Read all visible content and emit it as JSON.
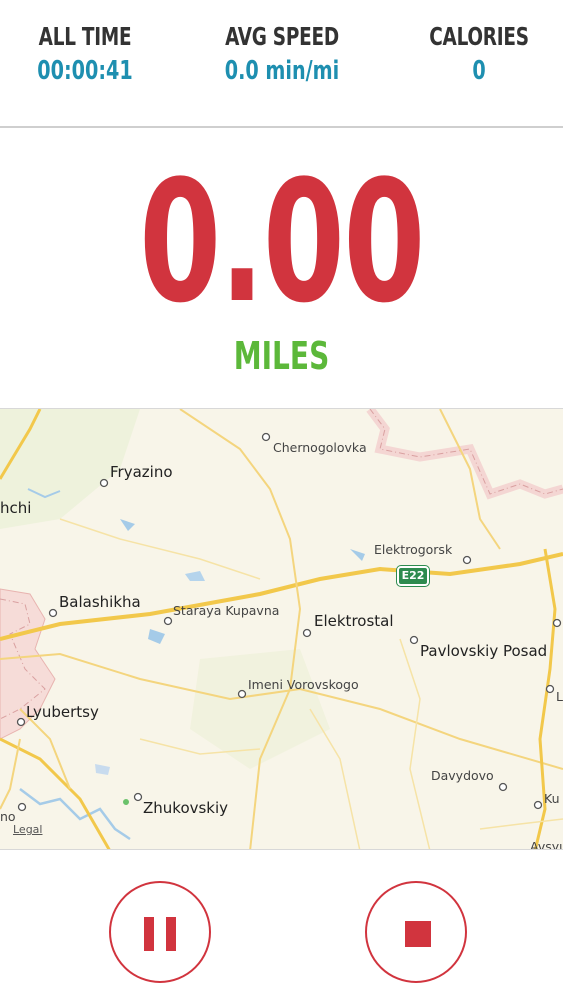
{
  "stats": [
    {
      "label": "ALL TIME",
      "value": "00:00:41"
    },
    {
      "label": "AVG SPEED",
      "value": "0.0 min/mi"
    },
    {
      "label": "CALORIES",
      "value": "0"
    }
  ],
  "distance": {
    "value": "0.00",
    "unit": "MILES"
  },
  "map": {
    "places": [
      {
        "name": "Chernogolovka",
        "size": "small"
      },
      {
        "name": "Fryazino",
        "size": "small"
      },
      {
        "name": "hchi",
        "size": "big"
      },
      {
        "name": "Elektrogorsk",
        "size": "small"
      },
      {
        "name": "Balashikha",
        "size": "big"
      },
      {
        "name": "Staraya Kupavna",
        "size": "small"
      },
      {
        "name": "Elektrostal",
        "size": "big"
      },
      {
        "name": "Pavlovskiy Posad",
        "size": "big"
      },
      {
        "name": "Imeni Vorovskogo",
        "size": "small"
      },
      {
        "name": "Lyubertsy",
        "size": "big"
      },
      {
        "name": "Davydovo",
        "size": "small"
      },
      {
        "name": "Zhukovskiy",
        "size": "big"
      },
      {
        "name": "Ku",
        "size": "small"
      },
      {
        "name": "L",
        "size": "small"
      },
      {
        "name": "Avsyu",
        "size": "small"
      },
      {
        "name": "no",
        "size": "small"
      }
    ],
    "highway_shield": "E22",
    "legal": "Legal"
  },
  "controls": {
    "pause": "pause-icon",
    "stop": "stop-icon"
  },
  "colors": {
    "accent_red": "#d1343e",
    "value_blue": "#1e8fb0",
    "unit_green": "#5cb83a"
  }
}
